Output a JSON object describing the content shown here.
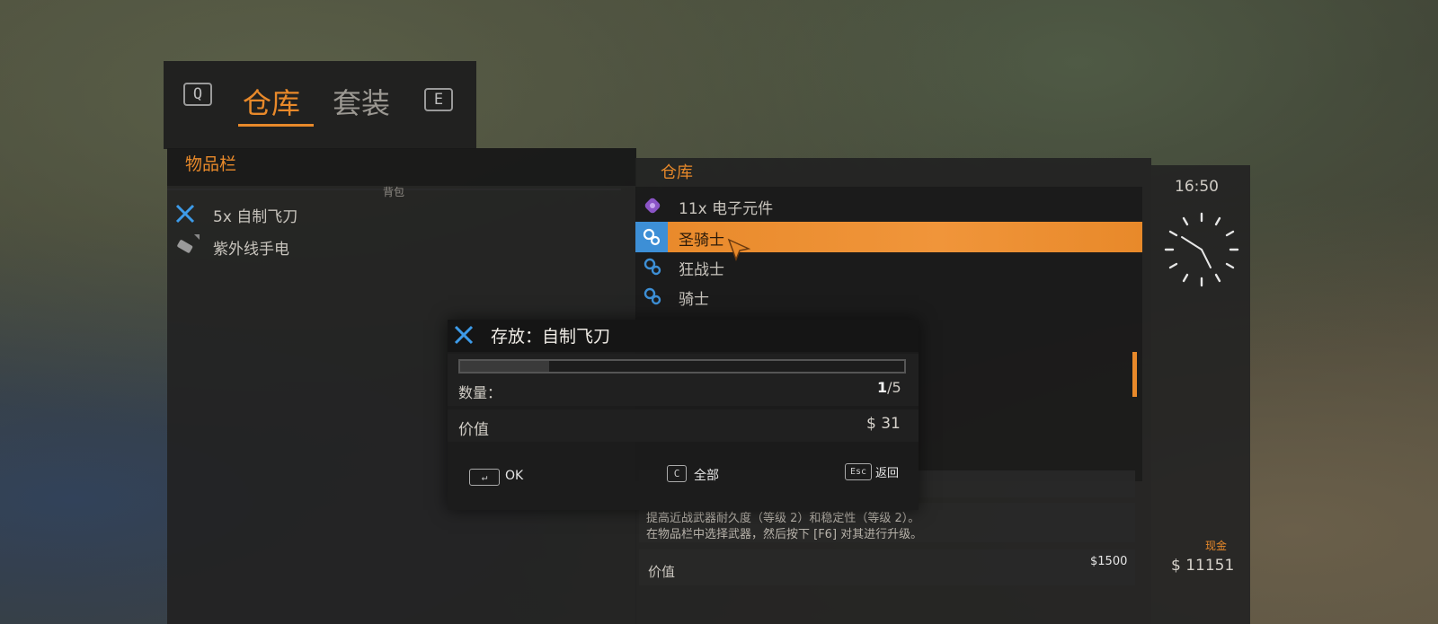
{
  "tabs": {
    "left_key": "Q",
    "right_key": "E",
    "items": [
      {
        "label": "仓库",
        "active": true
      },
      {
        "label": "套装",
        "active": false
      }
    ]
  },
  "inventory": {
    "title": "物品栏",
    "section_label": "背包",
    "items": [
      {
        "label": "5x 自制飞刀",
        "icon": "throwing-knife-icon"
      },
      {
        "label": "紫外线手电",
        "icon": "uv-flashlight-icon"
      }
    ]
  },
  "storage": {
    "title": "仓库",
    "items": [
      {
        "label": "11x 电子元件",
        "icon": "electronic-parts-icon",
        "selected": false
      },
      {
        "label": "圣骑士",
        "icon": "upgrade-gear-icon",
        "selected": true
      },
      {
        "label": "狂战士",
        "icon": "upgrade-gear-icon",
        "selected": false
      },
      {
        "label": "骑士",
        "icon": "upgrade-gear-icon",
        "selected": false
      }
    ],
    "description_line1": "提高近战武器耐久度（等级 2）和稳定性（等级 2）。",
    "description_line2": "在物品栏中选择武器，然后按下 [F6] 对其进行升级。",
    "value_label": "价值",
    "value_amount": "$1500"
  },
  "clock": {
    "time": "16:50"
  },
  "cash": {
    "label": "现金",
    "amount": "$ 11151"
  },
  "dialog": {
    "title": "存放：自制飞刀",
    "quantity_label": "数量：",
    "quantity_current": "1",
    "quantity_total": "/5",
    "quantity_fraction": 0.2,
    "value_label": "价值",
    "value_amount": "$ 31",
    "ok_key": "↵",
    "ok_label": "OK",
    "all_key": "C",
    "all_label": "全部",
    "back_key": "Esc",
    "back_label": "返回"
  },
  "colors": {
    "accent": "#e8892a",
    "selection_icon_bg": "#3d8fd6",
    "knife_icon": "#3d9be9"
  }
}
